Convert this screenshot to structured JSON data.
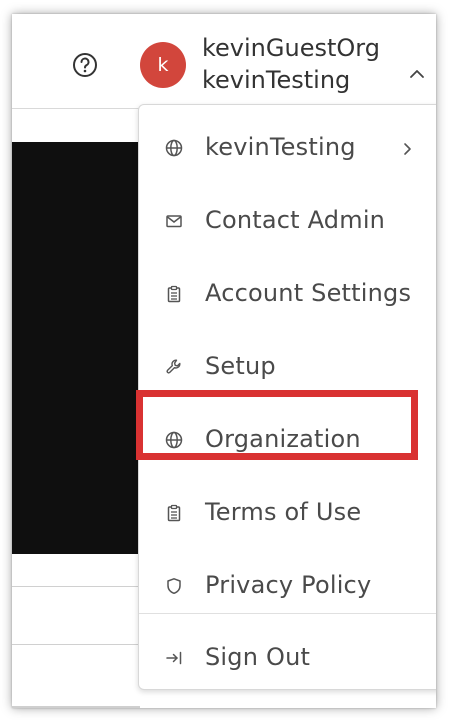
{
  "colors": {
    "avatar_bg": "#d2463c",
    "highlight": "#d93232",
    "menu_text": "#4a4a4a",
    "icon": "#555555"
  },
  "header": {
    "help_icon": "help-circle-icon",
    "avatar_initial": "k",
    "org_name": "kevinGuestOrg",
    "user_name": "kevinTesting",
    "expand_icon": "chevron-up-icon"
  },
  "menu": {
    "items": [
      {
        "label": "kevinTesting",
        "icon": "globe-icon",
        "has_submenu": true
      },
      {
        "label": "Contact Admin",
        "icon": "mail-icon"
      },
      {
        "label": "Account Settings",
        "icon": "clipboard-icon"
      },
      {
        "label": "Setup",
        "icon": "wrench-icon"
      },
      {
        "label": "Organization",
        "icon": "globe-icon",
        "highlighted": true
      },
      {
        "label": "Terms of Use",
        "icon": "clipboard-icon"
      },
      {
        "label": "Privacy Policy",
        "icon": "shield-icon"
      },
      {
        "label": "Sign Out",
        "icon": "sign-out-icon"
      }
    ]
  }
}
